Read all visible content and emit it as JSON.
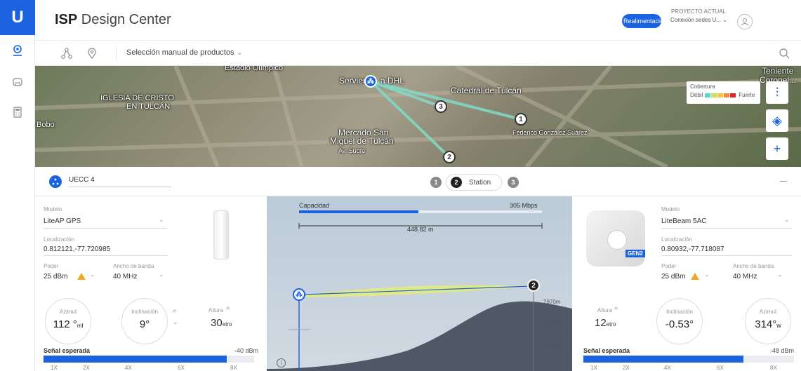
{
  "app": {
    "title_bold": "ISP",
    "title_rest": " Design Center",
    "feedback_label": "Realimentación",
    "project_label": "PROYECTO ACTUAL",
    "project_name": "Conexión sedes U... ⌄"
  },
  "toolbar": {
    "selector_label": "Selección manual de productos"
  },
  "map": {
    "labels": [
      "Estadio Olímpico",
      "Servien",
      "a DHL",
      "Catedral de Tulcán",
      "IGLESIA DE CRISTO",
      "EN TULCÁN",
      "Bobo",
      "Mercado San",
      "Miguel de Tulcán",
      "Av. Sucre",
      "Federico González Suárez",
      "Teniente",
      "Coronel..."
    ],
    "nodes": [
      "3",
      "1",
      "2"
    ],
    "coverage_title": "Cobertura",
    "coverage_weak": "Débil",
    "coverage_strong": "Fuerte",
    "accent": "#1b63e0"
  },
  "link": {
    "ap_name": "UECC 4",
    "steps": [
      "1",
      "2",
      "3"
    ],
    "active_step_label": "Station"
  },
  "left": {
    "model_label": "Modelo",
    "model_value": "LiteAP GPS",
    "location_label": "Localización",
    "location_value": "0.812121,-77.720985",
    "power_label": "Poder",
    "power_value": "25 dBm",
    "width_label": "Ancho de banda",
    "width_value": "40 MHz",
    "azimuth_label": "Azimut",
    "azimuth_value": "112 °",
    "azimuth_unit": "ml",
    "tilt_label": "Inclinación",
    "tilt_value": "9°",
    "height_label": "Altura",
    "height_value": "30",
    "height_unit": "etro",
    "signal_label": "Señal esperada",
    "signal_value": "-40 dBm",
    "signal_level": 0.87,
    "ticks": [
      "1X",
      "2X",
      "4X",
      "6X",
      "8X"
    ]
  },
  "center": {
    "capacity_label": "Capacidad",
    "capacity_value": "305 Mbps",
    "capacity_level": 0.49,
    "distance": "448.82 m",
    "elevations": [
      "2970m",
      "2960m",
      "2950m"
    ],
    "end_node": "2"
  },
  "right": {
    "model_label": "Modelo",
    "model_value": "LiteBeam 5AC",
    "badge": "GEN2",
    "location_label": "Localización",
    "location_value": "0.80932,-77.718087",
    "power_label": "Poder",
    "power_value": "25 dBm",
    "width_label": "Ancho de banda",
    "width_value": "40 MHz",
    "height_label": "Altura",
    "height_value": "12",
    "height_unit": "etro",
    "tilt_label": "Inclinación",
    "tilt_value": "-0.53°",
    "azimuth_label": "Azimut",
    "azimuth_value": "314°",
    "azimuth_unit": "w",
    "signal_label": "Señal esperada",
    "signal_value": "-48 dBm",
    "signal_level": 0.76,
    "ticks": [
      "1X",
      "2X",
      "4X",
      "6X",
      "8X"
    ]
  }
}
